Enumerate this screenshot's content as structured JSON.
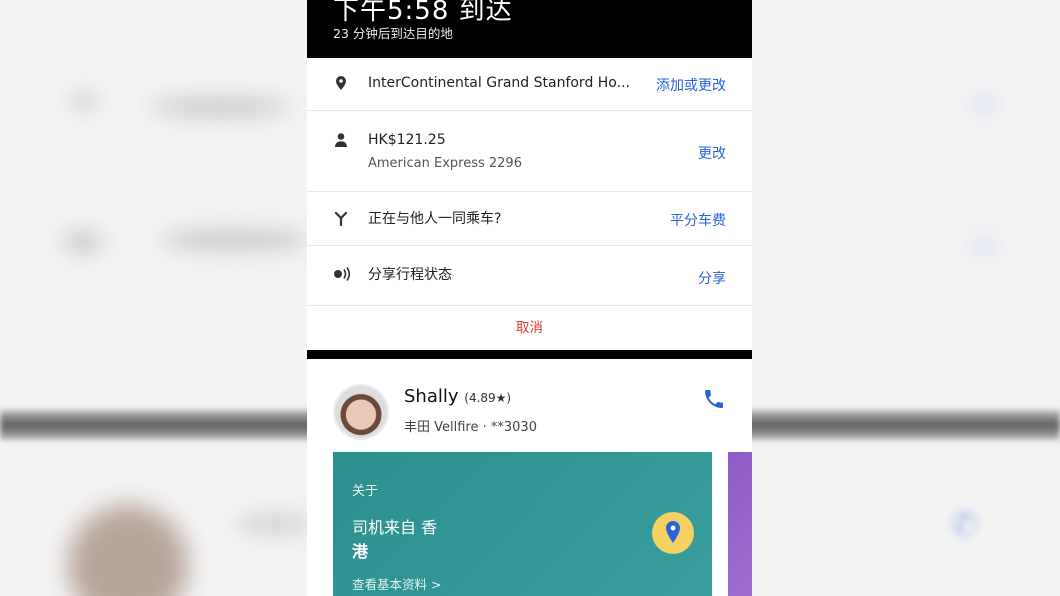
{
  "status": {
    "arrival_time": "下午5:58 到达",
    "eta_text": "23 分钟后到达目的地"
  },
  "trip_rows": [
    {
      "icon": "location-pin-icon",
      "main": "InterContinental Grand Stanford Ho...",
      "sub": "",
      "action": "添加或更改"
    },
    {
      "icon": "person-icon",
      "main": "HK$121.25",
      "sub": "American Express 2296",
      "action": "更改"
    },
    {
      "icon": "split-fare-icon",
      "main": "正在与他人一同乘车?",
      "sub": "",
      "action": "平分车费"
    },
    {
      "icon": "share-status-icon",
      "main": "分享行程状态",
      "sub": "",
      "action": "分享"
    }
  ],
  "cancel_label": "取消",
  "driver": {
    "name": "Shally",
    "rating": "(4.89★)",
    "vehicle": "丰田 Vellfire · **3030"
  },
  "about_card": {
    "heading": "关于",
    "line1": "司机来自 香",
    "line2": "港",
    "link": "查看基本资料 >"
  },
  "colors": {
    "accent_blue": "#2b63d9",
    "cancel_red": "#d93a2b",
    "card_teal": "#2c8f8f",
    "card_purple": "#8c5cc4",
    "badge_yellow": "#f4d160"
  }
}
